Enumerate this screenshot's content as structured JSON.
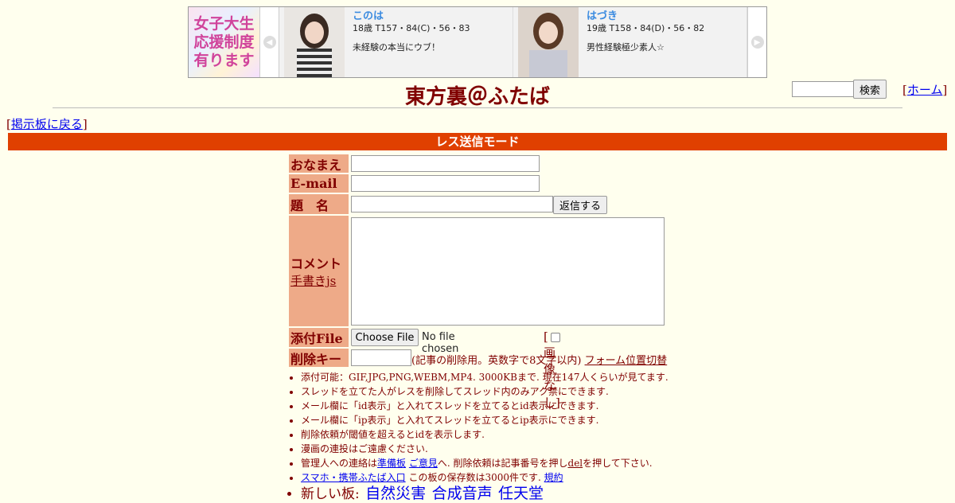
{
  "banner": {
    "ad_text": "女子大生\n応援制度\n有ります",
    "profiles": [
      {
        "name": "このは",
        "stats": "18歳 T157・84(C)・56・83",
        "desc": "未経験の本当にウブ！"
      },
      {
        "name": "はづき",
        "stats": "19歳 T158・84(D)・56・82",
        "desc": "男性経験極少素人☆"
      }
    ],
    "prev_arrow": "◀",
    "next_arrow": "▶"
  },
  "header": {
    "title": "東方裏＠ふたば",
    "search_button": "検索",
    "home_prefix": "[",
    "home_link": "ホーム",
    "home_suffix": "]"
  },
  "nav": {
    "back_prefix": "[",
    "back_link": "掲示板に戻る",
    "back_suffix": "]"
  },
  "mode_bar": "レス送信モード",
  "form": {
    "name_label": "おなまえ",
    "email_label": "E-mail",
    "subject_label": "題　名",
    "submit_button": "返信する",
    "comment_label": "コメント",
    "handwrite_link": "手書きjs",
    "file_label": "添付File",
    "choose_file_button": "Choose File",
    "no_file": "No file chosen",
    "noimg_open": "[",
    "noimg_text": "画像なし]",
    "delete_key_label": "削除キー",
    "delete_note": "(記事の削除用。英数字で8文字以内)",
    "form_toggle_link": "フォーム位置切替"
  },
  "notes": {
    "line1": "添付可能：GIF,JPG,PNG,WEBM,MP4. 3000KBまで. 現在147人くらいが見てます.",
    "line2": "スレッドを立てた人がレスを削除してスレッド内のみアク禁にできます.",
    "line3": "メール欄に「id表示」と入れてスレッドを立てるとid表示にできます.",
    "line4": "メール欄に「ip表示」と入れてスレッドを立てるとip表示にできます.",
    "line5": "削除依頼が閾値を超えるとidを表示します.",
    "line6": "漫画の連投はご遠慮ください.",
    "line7_pre": "管理人への連絡は",
    "line7_link1": "準備板",
    "line7_link2": "ご意見",
    "line7_mid": "へ. 削除依頼は記事番号を押し",
    "line7_del": "del",
    "line7_post": "を押して下さい.",
    "line8_link": "スマホ・携帯ふたば入口",
    "line8_mid": " この板の保存数は3000件です.",
    "line8_rule": "規約",
    "new_boards_label": "新しい板:",
    "new_boards": [
      "自然災害",
      "合成音声",
      "任天堂"
    ]
  }
}
